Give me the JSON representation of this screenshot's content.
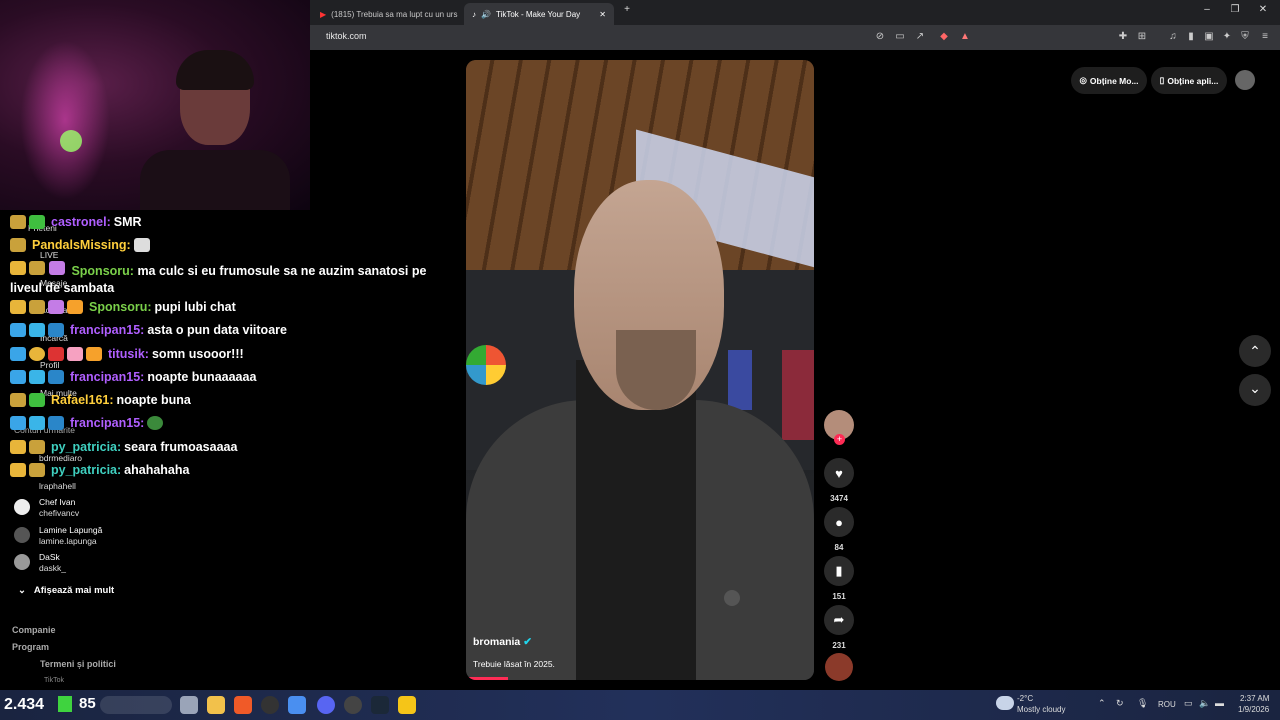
{
  "browser": {
    "tabs": [
      {
        "label": "(1815) Trebuia sa ma lupt cu un urs"
      },
      {
        "label": "TikTok - Make Your Day"
      }
    ],
    "url": "tiktok.com"
  },
  "header": {
    "get_coins": "Obține Mo...",
    "get_app": "Obține apli..."
  },
  "chat": [
    {
      "user": "castronel:",
      "message": "SMR",
      "color": "#b05fff"
    },
    {
      "user": "PandalsMissing:",
      "message": "",
      "color": "#ffcf3c"
    },
    {
      "user": "Sponsoru:",
      "message": "ma culc si eu frumosule sa ne auzim sanatosi pe liveul de sambata",
      "color": "#7ad04a"
    },
    {
      "user": "Sponsoru:",
      "message": "pupi lubi chat",
      "color": "#7ad04a"
    },
    {
      "user": "francipan15:",
      "message": "asta o pun data viitoare",
      "color": "#b05fff"
    },
    {
      "user": "titusik:",
      "message": "somn usooor!!!",
      "color": "#b05fff"
    },
    {
      "user": "francipan15:",
      "message": "noapte bunaaaaaa",
      "color": "#b05fff"
    },
    {
      "user": "Rafael161:",
      "message": "noapte buna",
      "color": "#ffcf3c"
    },
    {
      "user": "francipan15:",
      "message": "",
      "color": "#b05fff"
    },
    {
      "user": "py_patricia:",
      "message": "seara frumoasaaaa",
      "color": "#3fd0c0"
    },
    {
      "user": "py_patricia:",
      "message": "ahahahaha",
      "color": "#3fd0c0"
    }
  ],
  "sidebar": {
    "nav": [
      "Prieteni",
      "LIVE",
      "Mesaje",
      "Activitate",
      "Încarcă",
      "Profil",
      "Mai multe"
    ],
    "following_label": "Conturi urmărite",
    "following": [
      {
        "name": "bdrmediaro",
        "handle": ""
      },
      {
        "name": "lraphahell",
        "handle": ""
      },
      {
        "name": "Chef Ivan",
        "handle": "chefivancv"
      },
      {
        "name": "Lamine Lapungă",
        "handle": "lamine.lapunga"
      },
      {
        "name": "DaSk",
        "handle": "daskk_"
      }
    ],
    "show_more": "Afișează mai mult",
    "footer": [
      "Companie",
      "Program",
      "Termeni și politici"
    ],
    "copyright": "TikTok"
  },
  "video": {
    "author": "bromania",
    "caption": "Trebuie lăsat în 2025.",
    "progress": 0.12
  },
  "actions": {
    "likes": "3474",
    "comments": "84",
    "saves": "151",
    "shares": "231"
  },
  "stream_overlay": {
    "viewers": "2.434",
    "coins": "85"
  },
  "taskbar": {
    "temp": "-2°C",
    "weather": "Mostly cloudy",
    "lang": "ROU",
    "time": "2:37 AM",
    "date": "1/9/2026"
  }
}
